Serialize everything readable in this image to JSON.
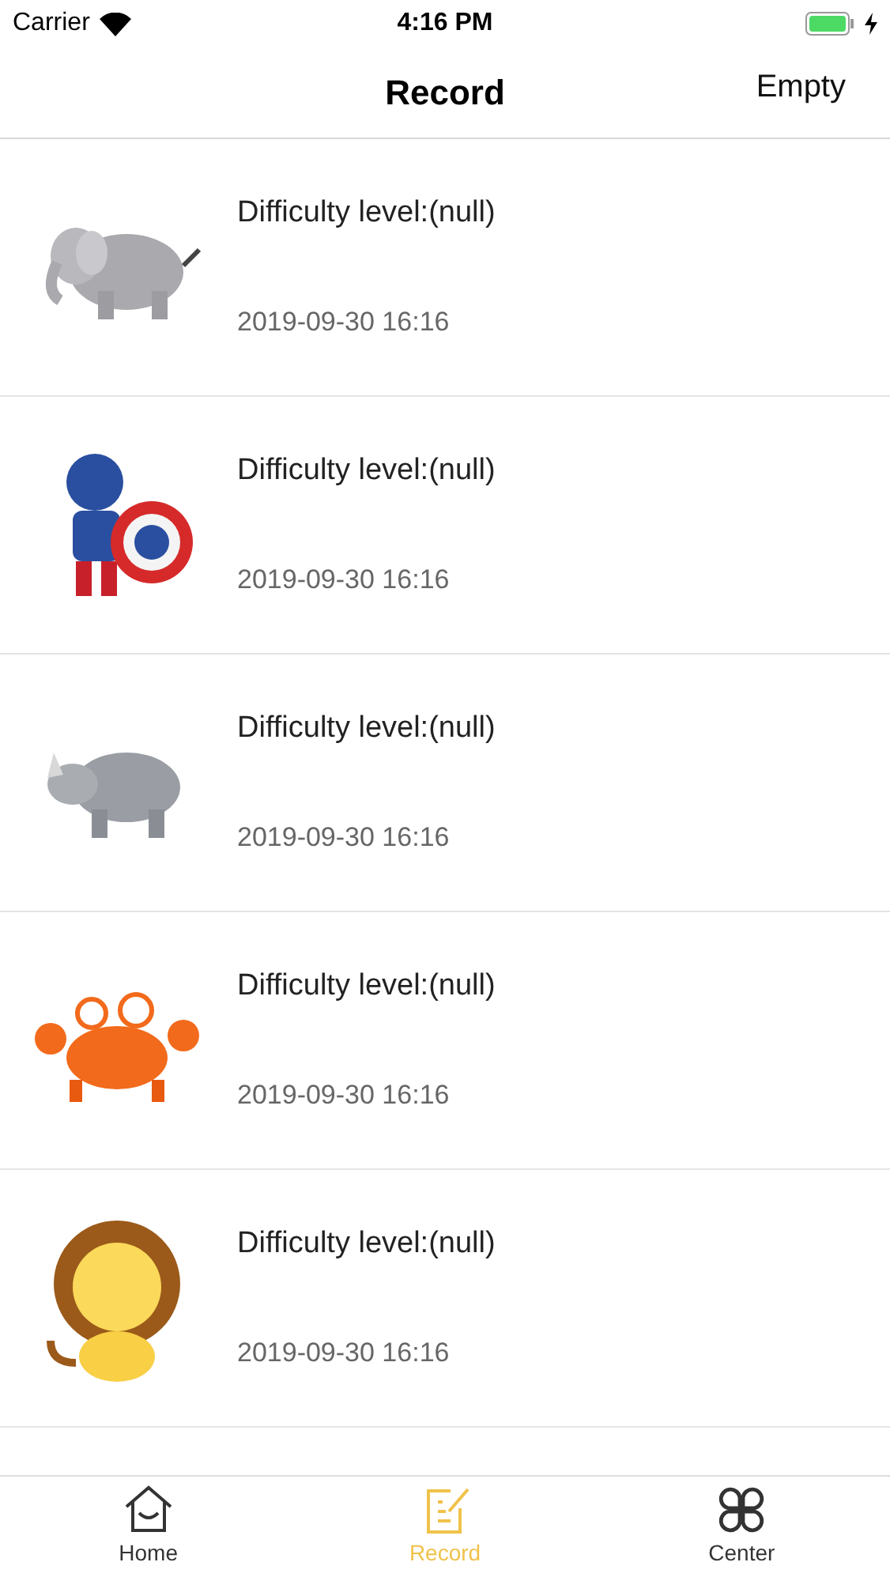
{
  "status_bar": {
    "carrier": "Carrier",
    "time": "4:16 PM"
  },
  "nav": {
    "title": "Record",
    "action": "Empty"
  },
  "records": [
    {
      "kind": "picture",
      "title": "Difficulty level:(null)",
      "date": "2019-09-30 16:16"
    },
    {
      "kind": "picture",
      "title": "Difficulty level:(null)",
      "date": "2019-09-30 16:16"
    },
    {
      "kind": "picture",
      "title": "Difficulty level:(null)",
      "date": "2019-09-30 16:16"
    },
    {
      "kind": "picture",
      "title": "Difficulty level:(null)",
      "date": "2019-09-30 16:16"
    },
    {
      "kind": "picture",
      "title": "Difficulty level:(null)",
      "date": "2019-09-30 16:16"
    }
  ],
  "tabs": [
    {
      "label": "Home",
      "selected": false
    },
    {
      "label": "Record",
      "selected": true
    },
    {
      "label": "Center",
      "selected": false
    }
  ]
}
